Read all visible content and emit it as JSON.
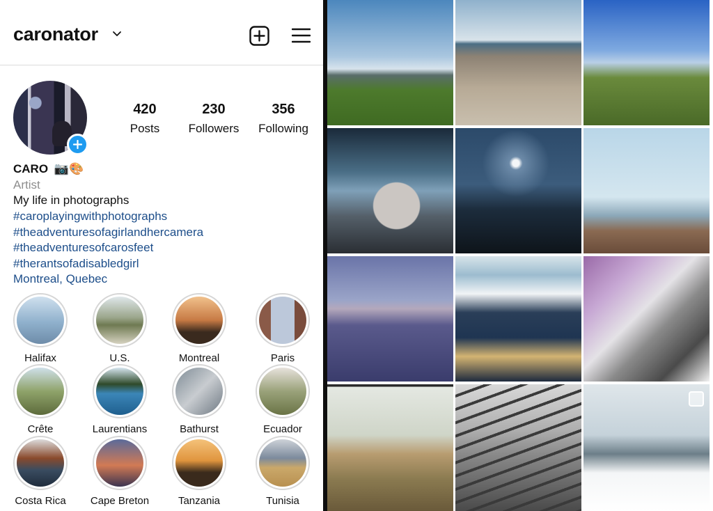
{
  "header": {
    "username": "caronator"
  },
  "stats": [
    {
      "value": "420",
      "label": "Posts"
    },
    {
      "value": "230",
      "label": "Followers"
    },
    {
      "value": "356",
      "label": "Following"
    }
  ],
  "bio": {
    "name": "CARO",
    "name_emoji": "📷🎨",
    "category": "Artist",
    "text": "My life in photographs",
    "hashtags": [
      "#caroplayingwithphotographs",
      "#theadventuresofagirlandhercamera",
      "#theadventuresofcarosfeet",
      "#therantsofadisabledgirl"
    ],
    "location": "Montreal, Quebec"
  },
  "highlights": [
    {
      "label": "Halifax"
    },
    {
      "label": "U.S."
    },
    {
      "label": "Montreal"
    },
    {
      "label": "Paris"
    },
    {
      "label": "Crête"
    },
    {
      "label": "Laurentians"
    },
    {
      "label": "Bathurst"
    },
    {
      "label": "Ecuador"
    },
    {
      "label": "Costa Rica"
    },
    {
      "label": "Cape Breton"
    },
    {
      "label": "Tanzania"
    },
    {
      "label": "Tunisia"
    }
  ],
  "icons": {
    "chevron": "chevron-down-icon",
    "new_post": "plus-square-icon",
    "menu": "hamburger-menu-icon",
    "add_story": "plus-circle-icon",
    "multi_post": "multiple-photos-icon"
  },
  "colors": {
    "link": "#1d4e8a",
    "secondary_text": "#8e8e8e",
    "add_story_blue": "#1e9bf0"
  }
}
